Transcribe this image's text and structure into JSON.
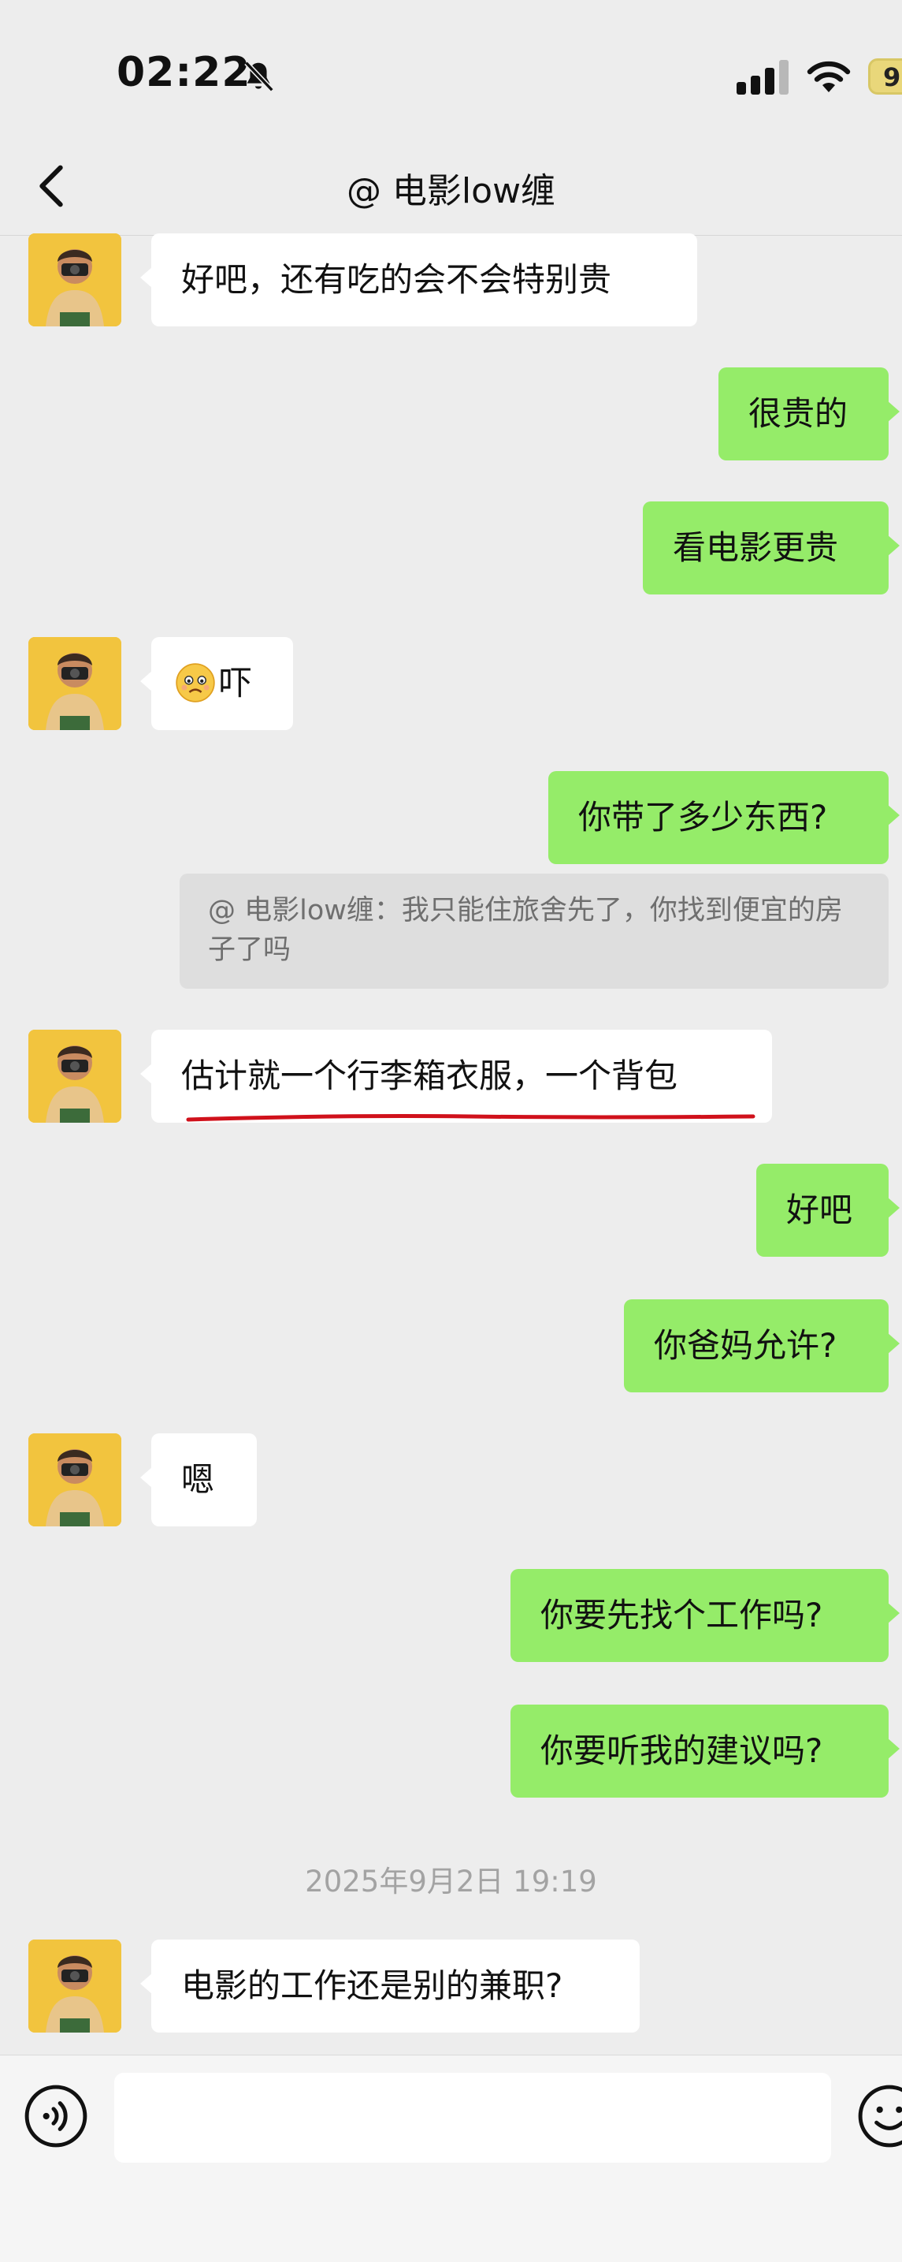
{
  "status_bar": {
    "time": "02:22",
    "battery": "9"
  },
  "header": {
    "title": "@ 电影low缠"
  },
  "messages": [
    {
      "side": "left",
      "text": "好吧，还有吃的会不会特别贵"
    },
    {
      "side": "right",
      "text": "很贵的"
    },
    {
      "side": "right",
      "text": "看电影更贵"
    },
    {
      "side": "left",
      "emoji": "worried-face-emoji",
      "text": "吓"
    },
    {
      "side": "right",
      "text": "你带了多少东西?"
    },
    {
      "side": "right",
      "type": "quote",
      "text": "@ 电影low缠：我只能住旅舍先了，你找到便宜的房子了吗"
    },
    {
      "side": "left",
      "text": "估计就一个行李箱衣服，一个背包",
      "underline_color": "#d0111b"
    },
    {
      "side": "right",
      "text": "好吧"
    },
    {
      "side": "right",
      "text": "你爸妈允许?"
    },
    {
      "side": "left",
      "text": "嗯"
    },
    {
      "side": "right",
      "text": "你要先找个工作吗?"
    },
    {
      "side": "right",
      "text": "你要听我的建议吗?"
    },
    {
      "side": "left",
      "text": "电影的工作还是别的兼职?"
    }
  ],
  "timestamp": "2025年9月2日 19:19",
  "colors": {
    "sent_bubble": "#95ec69",
    "received_bubble": "#ffffff",
    "background": "#ededed"
  },
  "icons": [
    "bell-muted-icon",
    "signal-icon",
    "wifi-icon",
    "battery-icon",
    "back-chevron-icon",
    "voice-icon",
    "emoji-icon"
  ]
}
